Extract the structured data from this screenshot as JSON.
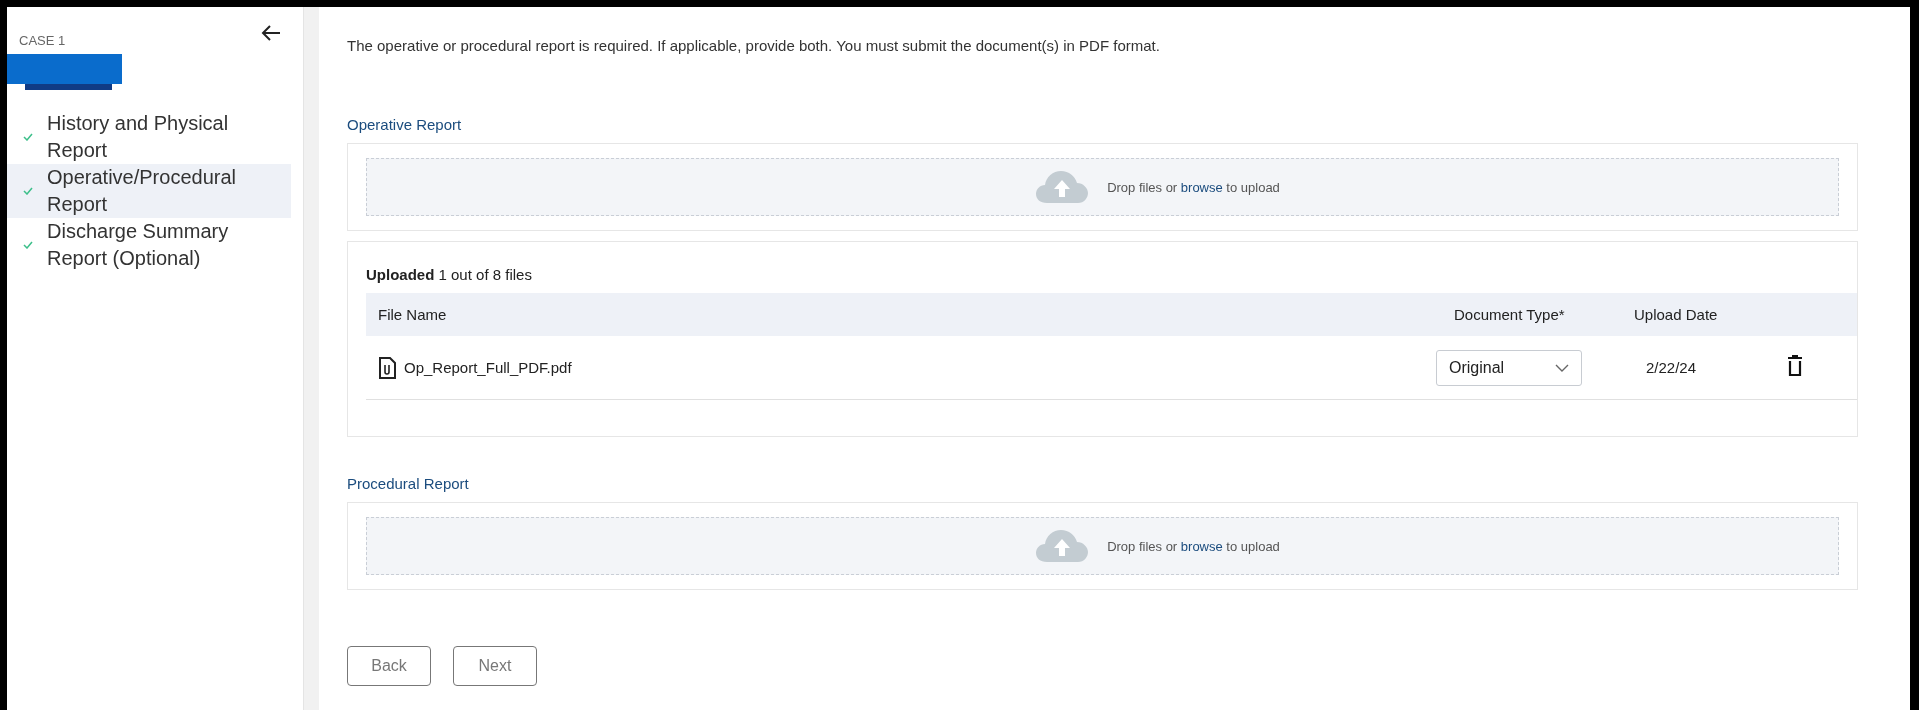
{
  "sidebar": {
    "case_label": "CASE 1",
    "items": [
      {
        "label": "History and Physical Report",
        "checked": true,
        "selected": false
      },
      {
        "label": "Operative/Procedural Report",
        "checked": true,
        "selected": true
      },
      {
        "label": "Discharge Summary Report (Optional)",
        "checked": true,
        "selected": false
      }
    ]
  },
  "instructions": "The operative or procedural report is required. If applicable, provide both. You must submit the document(s) in PDF format.",
  "sections": [
    {
      "title": "Operative Report",
      "dropzone": {
        "before": "Drop files or",
        "link": "browse",
        "after": "to upload"
      },
      "uploads": {
        "summary": "**Uploaded** 1 out of 8 files",
        "columns": [
          "File Name",
          "Document Type*",
          "Upload Date"
        ],
        "rows": [
          {
            "file_name": "Op_Report_Full_PDF.pdf",
            "document_type": "Original",
            "upload_date": "2/22/24"
          }
        ]
      }
    },
    {
      "title": "Procedural Report",
      "dropzone": {
        "before": "Drop files or",
        "link": "browse",
        "after": "to upload"
      }
    }
  ],
  "buttons": [
    "Back",
    "Next"
  ]
}
